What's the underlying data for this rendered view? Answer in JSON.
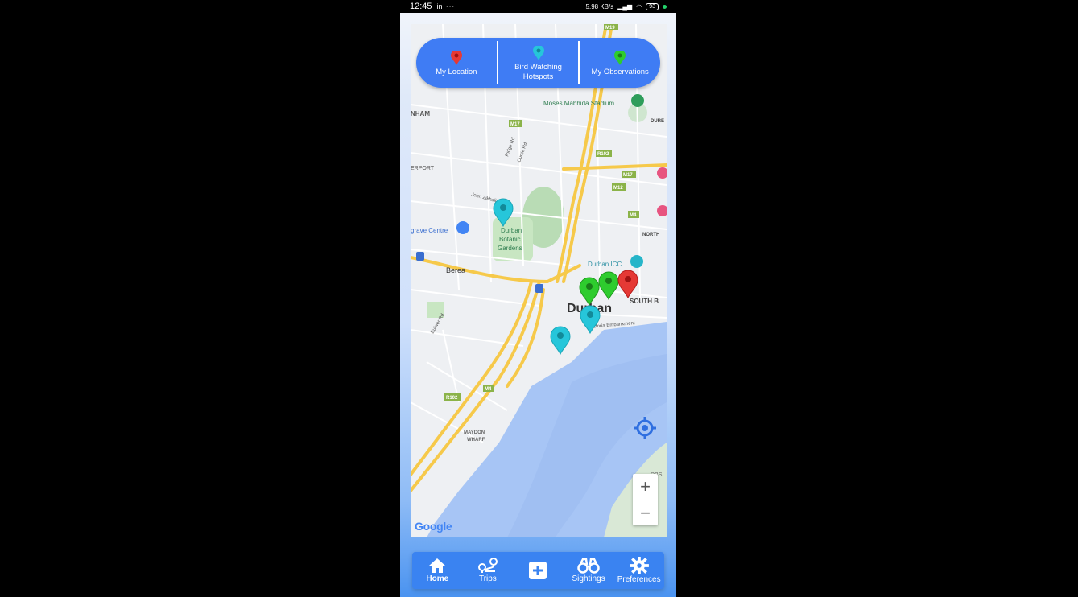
{
  "status_bar": {
    "time": "12:45",
    "battery": "93",
    "net_speed": "5.98 KB/s"
  },
  "legend": {
    "my_location": "My Location",
    "hotspots_line1": "Bird Watching",
    "hotspots_line2": "Hotspots",
    "observations": "My Observations"
  },
  "map": {
    "attribution": "Google",
    "labels": {
      "stadium": "Moses Mabhida Stadium",
      "nham": "NHAM",
      "erport": "ERPORT",
      "durban": "Durban",
      "botanic1": "Durban",
      "botanic2": "Botanic",
      "botanic3": "Gardens",
      "berea": "Berea",
      "grave": "grave Centre",
      "icc": "Durban ICC",
      "south_b": "SOUTH B",
      "north": "NORTH",
      "dure": "DURE",
      "maydon1": "MAYDON",
      "maydon2": "WHARF",
      "dbs": "DBS",
      "john_zikhali": "John Zikhali",
      "victoria": "Victoria Embankment",
      "bulwer": "Bulwer Rd",
      "currie": "Currie Rd",
      "ridge": "Ridge Rd"
    },
    "road_shields": [
      "M17",
      "R102",
      "M17",
      "M12",
      "M4",
      "R102",
      "M4",
      "M19"
    ]
  },
  "colors": {
    "accent": "#3f7cf4",
    "my_location_pin": "#e53935",
    "hotspot_pin": "#26c6da",
    "observation_pin": "#2ecc2e"
  },
  "nav": {
    "home": "Home",
    "trips": "Trips",
    "sightings": "Sightings",
    "preferences": "Preferences"
  }
}
